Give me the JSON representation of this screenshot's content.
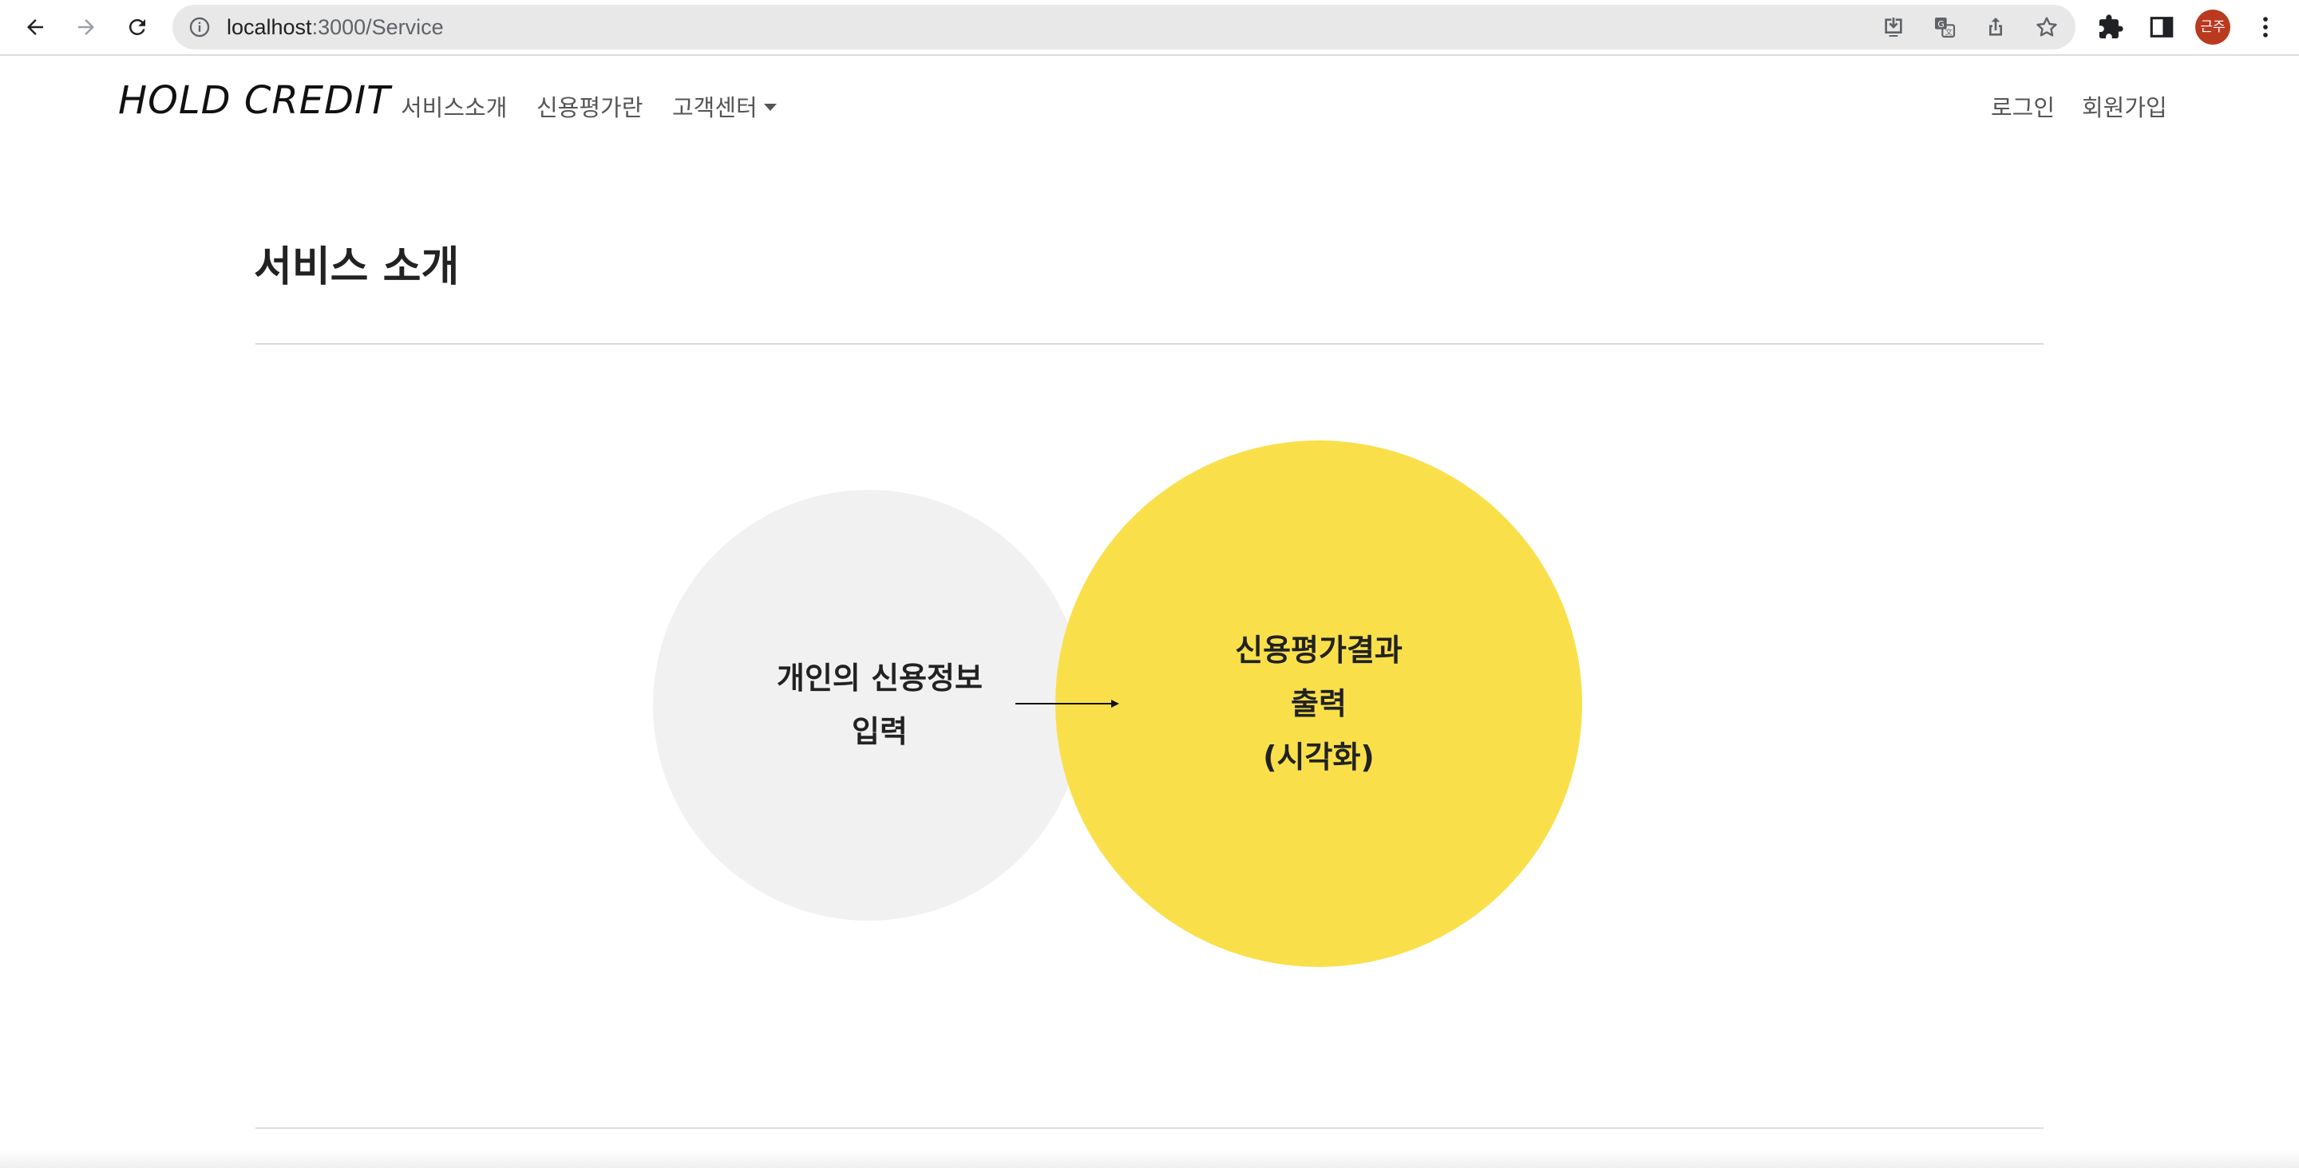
{
  "browser": {
    "url_host": "localhost",
    "url_rest": ":3000/Service",
    "profile_initials": "근주"
  },
  "navbar": {
    "brand": "HOLD CREDIT",
    "links": [
      "서비스소개",
      "신용평가란",
      "고객센터"
    ],
    "auth": {
      "login": "로그인",
      "signup": "회원가입"
    }
  },
  "main": {
    "title": "서비스 소개",
    "diagram": {
      "input_circle": {
        "lines": [
          "개인의 신용정보",
          "입력"
        ],
        "color": "#f1f1f1"
      },
      "output_circle": {
        "lines": [
          "신용평가결과",
          "출력",
          "(시각화)"
        ],
        "color": "#f9e04b"
      }
    }
  }
}
